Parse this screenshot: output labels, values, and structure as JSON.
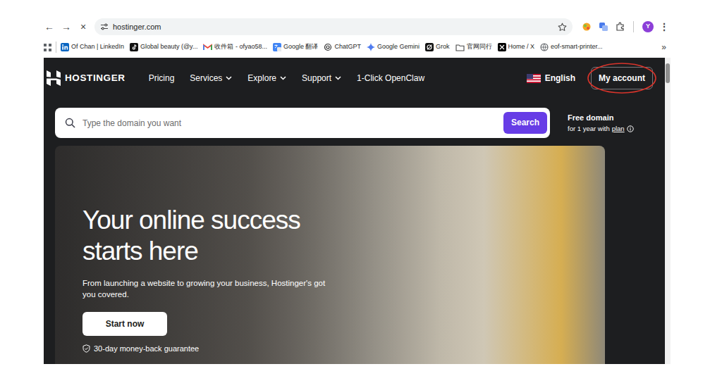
{
  "browser": {
    "nav_buttons": [
      "←",
      "→",
      "×"
    ],
    "url": "hostinger.com",
    "profile_initial": "Y",
    "menu_glyph": "⋮",
    "bookmarks": [
      {
        "label": "Of Chan | LinkedIn",
        "kind": "linkedin"
      },
      {
        "label": "Global beauty (@y...",
        "kind": "tiktok"
      },
      {
        "label": "收件箱 - ofyao58...",
        "kind": "gmail"
      },
      {
        "label": "Google 翻译",
        "kind": "translate"
      },
      {
        "label": "ChatGPT",
        "kind": "chatgpt"
      },
      {
        "label": "Google Gemini",
        "kind": "gemini"
      },
      {
        "label": "Grok",
        "kind": "grok"
      },
      {
        "label": "官网同行",
        "kind": "folder"
      },
      {
        "label": "Home / X",
        "kind": "x"
      },
      {
        "label": "eof-smart-printer...",
        "kind": "site"
      }
    ],
    "bookmarks_more": "»"
  },
  "page": {
    "logo": "HOSTINGER",
    "nav": [
      {
        "label": "Pricing",
        "dropdown": false
      },
      {
        "label": "Services",
        "dropdown": true
      },
      {
        "label": "Explore",
        "dropdown": true
      },
      {
        "label": "Support",
        "dropdown": true
      },
      {
        "label": "1-Click OpenClaw",
        "dropdown": false
      }
    ],
    "language": "English",
    "account_button": {
      "label": "My account",
      "circled": true
    },
    "search": {
      "placeholder": "Type the domain you want",
      "button": "Search"
    },
    "promo": {
      "title": "Free domain",
      "text": "for 1 year with",
      "link": "plan"
    },
    "hero": {
      "title": "Your online success starts here",
      "text": "From launching a website to growing your business, Hostinger's got you covered.",
      "button": "Start now",
      "guarantee": "30-day money-back guarantee"
    }
  }
}
